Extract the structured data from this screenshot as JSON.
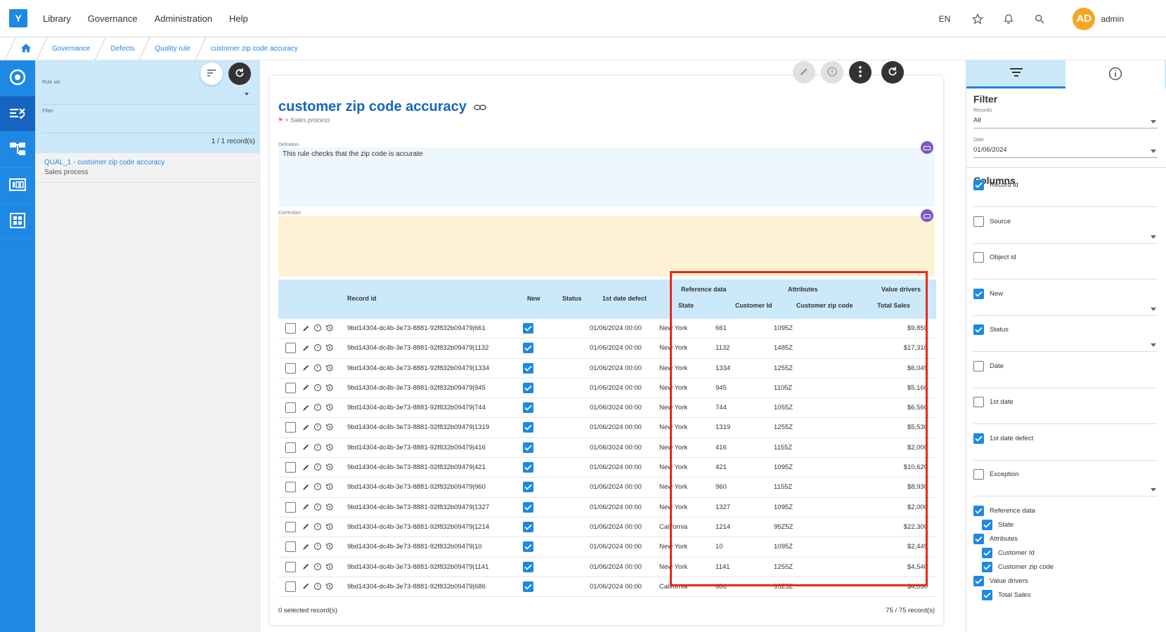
{
  "app": {
    "logo": "Y",
    "menu": [
      "Library",
      "Governance",
      "Administration",
      "Help"
    ],
    "lang": "EN",
    "avatar_initials": "AD",
    "username": "admin"
  },
  "breadcrumb": [
    "Governance",
    "Defects",
    "Quality rule",
    "customer zip code accuracy"
  ],
  "list": {
    "ruleset_label": "Rule set",
    "filter_label": "Filter",
    "count": "1 / 1 record(s)",
    "items": [
      {
        "title": "QUAL_1 - customer zip code accuracy",
        "sub": "Sales process"
      }
    ]
  },
  "detail": {
    "title": "customer zip code accuracy",
    "path": "Sales process",
    "definition_label": "Definition",
    "definition_text": "This rule checks that the zip code is accurate",
    "correction_label": "Correction"
  },
  "table": {
    "headers": {
      "record_id": "Record id",
      "new": "New",
      "status": "Status",
      "first_date_defect": "1st date defect",
      "group_reference": "Reference data",
      "group_attributes": "Attributes",
      "group_value_drivers": "Value drivers",
      "state": "State",
      "customer_id": "Customer Id",
      "zip": "Customer zip code",
      "total_sales": "Total Sales"
    },
    "rows": [
      {
        "id": "9bd14304-dc4b-3e73-8881-92f832b09479|661",
        "date": "01/06/2024 00:00",
        "state": "New York",
        "cid": "661",
        "zip": "1095Z",
        "sales": "$9,850"
      },
      {
        "id": "9bd14304-dc4b-3e73-8881-92f832b09479|1132",
        "date": "01/06/2024 00:00",
        "state": "New York",
        "cid": "1132",
        "zip": "1485Z",
        "sales": "$17,310"
      },
      {
        "id": "9bd14304-dc4b-3e73-8881-92f832b09479|1334",
        "date": "01/06/2024 00:00",
        "state": "New York",
        "cid": "1334",
        "zip": "1255Z",
        "sales": "$6,049"
      },
      {
        "id": "9bd14304-dc4b-3e73-8881-92f832b09479|945",
        "date": "01/06/2024 00:00",
        "state": "New York",
        "cid": "945",
        "zip": "1105Z",
        "sales": "$5,160"
      },
      {
        "id": "9bd14304-dc4b-3e73-8881-92f832b09479|744",
        "date": "01/06/2024 00:00",
        "state": "New York",
        "cid": "744",
        "zip": "1055Z",
        "sales": "$6,560"
      },
      {
        "id": "9bd14304-dc4b-3e73-8881-92f832b09479|1319",
        "date": "01/06/2024 00:00",
        "state": "New York",
        "cid": "1319",
        "zip": "1255Z",
        "sales": "$5,530"
      },
      {
        "id": "9bd14304-dc4b-3e73-8881-92f832b09479|416",
        "date": "01/06/2024 00:00",
        "state": "New York",
        "cid": "416",
        "zip": "1155Z",
        "sales": "$2,000"
      },
      {
        "id": "9bd14304-dc4b-3e73-8881-92f832b09479|421",
        "date": "01/06/2024 00:00",
        "state": "New York",
        "cid": "421",
        "zip": "1095Z",
        "sales": "$10,620"
      },
      {
        "id": "9bd14304-dc4b-3e73-8881-92f832b09479|960",
        "date": "01/06/2024 00:00",
        "state": "New York",
        "cid": "960",
        "zip": "1155Z",
        "sales": "$8,930"
      },
      {
        "id": "9bd14304-dc4b-3e73-8881-92f832b09479|1327",
        "date": "01/06/2024 00:00",
        "state": "New York",
        "cid": "1327",
        "zip": "1095Z",
        "sales": "$2,000"
      },
      {
        "id": "9bd14304-dc4b-3e73-8881-92f832b09479|1214",
        "date": "01/06/2024 00:00",
        "state": "California",
        "cid": "1214",
        "zip": "95Z5Z",
        "sales": "$22,300"
      },
      {
        "id": "9bd14304-dc4b-3e73-8881-92f832b09479|10",
        "date": "01/06/2024 00:00",
        "state": "New York",
        "cid": "10",
        "zip": "1095Z",
        "sales": "$2,449"
      },
      {
        "id": "9bd14304-dc4b-3e73-8881-92f832b09479|1141",
        "date": "01/06/2024 00:00",
        "state": "New York",
        "cid": "1141",
        "zip": "1255Z",
        "sales": "$4,540"
      },
      {
        "id": "9bd14304-dc4b-3e73-8881-92f832b09479|686",
        "date": "01/06/2024 00:00",
        "state": "California",
        "cid": "686",
        "zip": "95Z5Z",
        "sales": "$4,030"
      }
    ],
    "selected": "0 selected record(s)",
    "total": "75 / 75 record(s)"
  },
  "filter_panel": {
    "filter_title": "Filter",
    "records_label": "Records",
    "records_value": "All",
    "date_label": "Date",
    "date_value": "01/06/2024",
    "columns_title": "Columns",
    "columns": [
      {
        "label": "Record id",
        "checked": true
      },
      {
        "label": "Source",
        "checked": false
      },
      {
        "label": "Object id",
        "checked": false
      },
      {
        "label": "New",
        "checked": true
      },
      {
        "label": "Status",
        "checked": true
      },
      {
        "label": "Date",
        "checked": false
      },
      {
        "label": "1st date",
        "checked": false
      },
      {
        "label": "1st date defect",
        "checked": true
      },
      {
        "label": "Exception",
        "checked": false
      }
    ],
    "groups": [
      {
        "label": "Reference data",
        "children": [
          "State"
        ]
      },
      {
        "label": "Attributes",
        "children": [
          "Customer Id",
          "Customer zip code"
        ]
      },
      {
        "label": "Value drivers",
        "children": [
          "Total Sales"
        ]
      }
    ]
  },
  "colors": {
    "primary": "#1e88e5",
    "header_bg": "#cbe9fb",
    "highlight": "#e8281e",
    "avatar": "#f5a623"
  }
}
